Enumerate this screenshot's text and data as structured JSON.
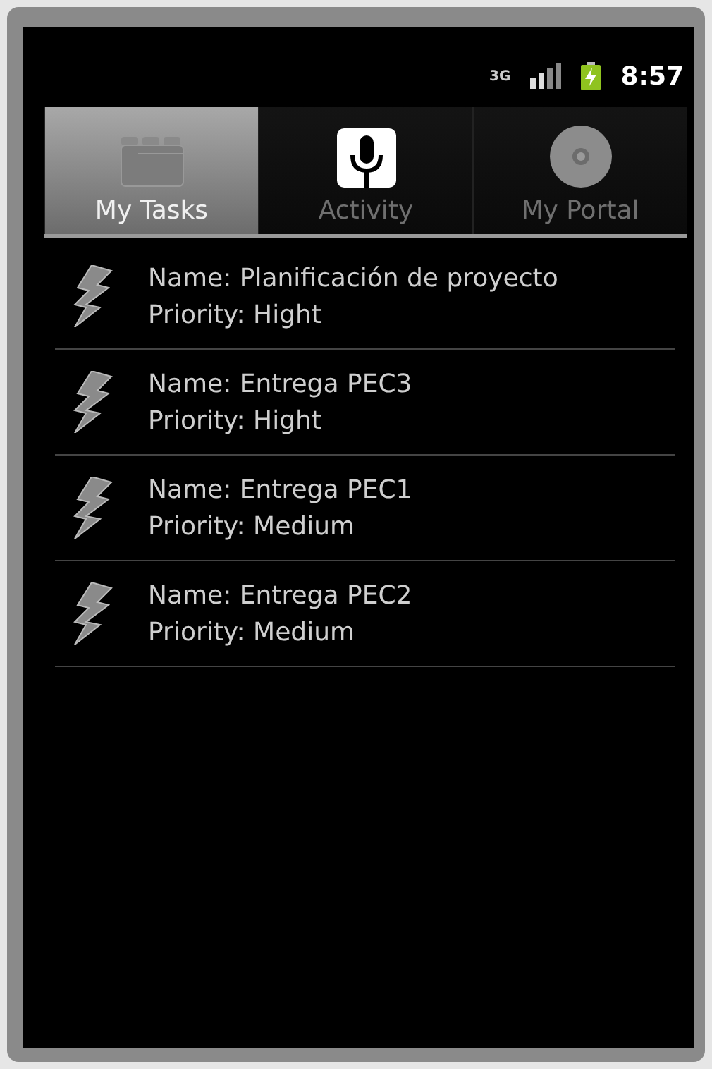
{
  "status_bar": {
    "network": "3G",
    "time": "8:57"
  },
  "tabs": [
    {
      "label": "My Tasks",
      "selected": true
    },
    {
      "label": "Activity",
      "selected": false
    },
    {
      "label": "My Portal",
      "selected": false
    }
  ],
  "tasks": [
    {
      "name": "Name: Planificación de proyecto",
      "priority": "Priority: Hight"
    },
    {
      "name": "Name: Entrega PEC3",
      "priority": "Priority: Hight"
    },
    {
      "name": "Name: Entrega PEC1",
      "priority": "Priority: Medium"
    },
    {
      "name": "Name: Entrega PEC2",
      "priority": "Priority: Medium"
    }
  ]
}
